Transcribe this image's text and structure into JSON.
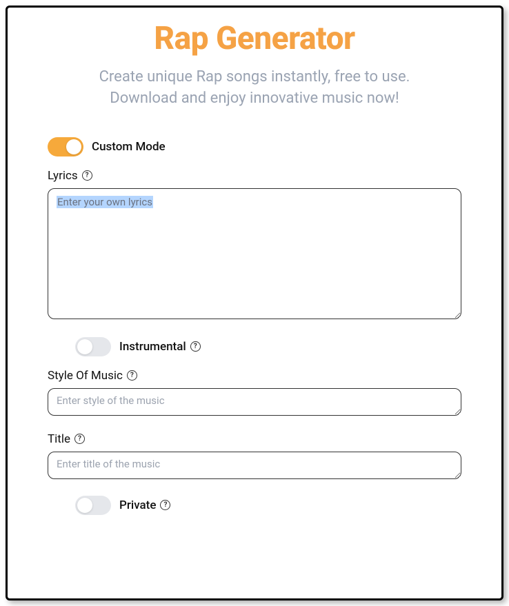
{
  "header": {
    "title": "Rap Generator",
    "subtitle_line1": "Create unique Rap songs instantly, free to use.",
    "subtitle_line2": "Download and enjoy innovative music now!"
  },
  "customMode": {
    "label": "Custom Mode",
    "on": true
  },
  "lyrics": {
    "label": "Lyrics",
    "placeholder": "Enter your own lyrics",
    "value": ""
  },
  "instrumental": {
    "label": "Instrumental",
    "on": false
  },
  "style": {
    "label": "Style Of Music",
    "placeholder": "Enter style of the music",
    "value": ""
  },
  "titleField": {
    "label": "Title",
    "placeholder": "Enter title of the music",
    "value": ""
  },
  "private": {
    "label": "Private",
    "on": false
  },
  "helpGlyph": "?"
}
